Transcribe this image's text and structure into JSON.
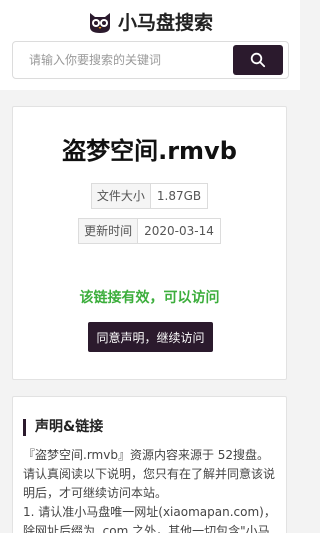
{
  "header": {
    "brand_name": "小马盘搜索",
    "logo_icon": "owl-logo-icon"
  },
  "search": {
    "placeholder": "请输入你要搜索的关键词",
    "button_icon": "search-icon"
  },
  "file": {
    "title": "盗梦空间.rmvb",
    "size_label": "文件大小",
    "size_value": "1.87GB",
    "time_label": "更新时间",
    "time_value": "2020-03-14",
    "status_message": "该链接有效，可以访问",
    "agree_button": "同意声明，继续访问"
  },
  "declaration": {
    "title": "声明&链接",
    "para1": "『盗梦空间.rmvb』资源内容来源于 52搜盘。",
    "para2": "请认真阅读以下说明，您只有在了解并同意该说明后，才可继续访问本站。",
    "para3": "1. 请认准小马盘唯一网址(xiaomapan.com)，除网址后缀为 .com 之外，其他一切包含\"小马"
  },
  "colors": {
    "accent": "#2b1a2d",
    "status_green": "#3cae3c"
  }
}
